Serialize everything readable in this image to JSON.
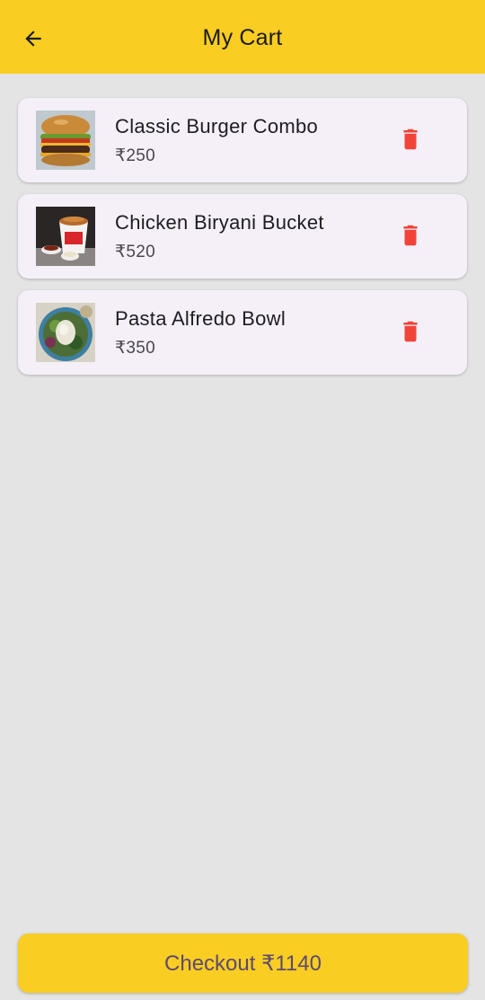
{
  "header": {
    "title": "My Cart",
    "back_icon": "arrow-left-icon",
    "background": "#f9cd22"
  },
  "cart": {
    "items": [
      {
        "name": "Classic Burger Combo",
        "price": "₹250",
        "image": "burger-image",
        "delete_icon": "trash-icon"
      },
      {
        "name": "Chicken Biryani Bucket",
        "price": "₹520",
        "image": "biryani-image",
        "delete_icon": "trash-icon"
      },
      {
        "name": "Pasta Alfredo Bowl",
        "price": "₹350",
        "image": "pasta-image",
        "delete_icon": "trash-icon"
      }
    ]
  },
  "checkout": {
    "label": "Checkout ₹1140"
  },
  "colors": {
    "accent": "#f9cd22",
    "delete": "#f0443a",
    "card": "#f5f0f8",
    "background": "#e4e4e4",
    "checkout_text": "#5e4a6e"
  }
}
